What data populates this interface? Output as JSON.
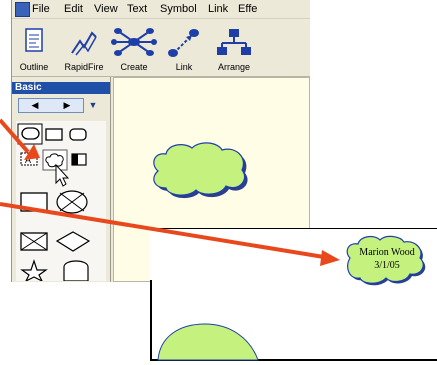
{
  "app": {
    "menu": [
      "File",
      "Edit",
      "View",
      "Text",
      "Symbol",
      "Link",
      "Effe"
    ],
    "toolbar": [
      {
        "label": "Outline",
        "icon": "outline-icon"
      },
      {
        "label": "RapidFire",
        "icon": "rapidfire-icon"
      },
      {
        "label": "Create",
        "icon": "create-icon"
      },
      {
        "label": "Link",
        "icon": "link-icon"
      },
      {
        "label": "Arrange",
        "icon": "arrange-icon"
      }
    ],
    "palette": {
      "title": "Basic"
    }
  },
  "zoomed_cloud": {
    "line1": "Marion Wood",
    "line2": "3/1/05"
  },
  "colors": {
    "cloud_fill": "#c5f27e",
    "cloud_stroke": "#1f3fa8",
    "arrow": "#e8481b",
    "canvas_bg": "#fffde6",
    "toolbar_icon_blue": "#1f3fa8"
  }
}
